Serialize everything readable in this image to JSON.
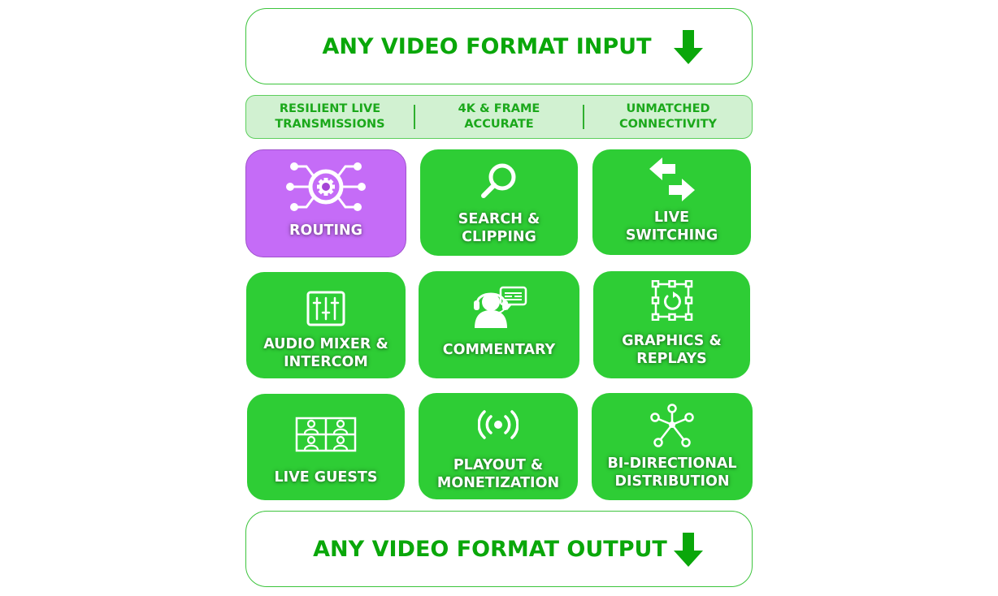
{
  "input_banner": {
    "label": "ANY VIDEO FORMAT INPUT",
    "icon": "arrow-down-icon"
  },
  "features": [
    {
      "label": "RESILIENT LIVE\nTRANSMISSIONS"
    },
    {
      "label": "4K & FRAME\nACCURATE"
    },
    {
      "label": "UNMATCHED\nCONNECTIVITY"
    }
  ],
  "tiles": [
    {
      "label": "ROUTING",
      "icon": "routing-gear-icon",
      "color": "#c56cf7"
    },
    {
      "label": "SEARCH &\nCLIPPING",
      "icon": "search-icon",
      "color": "#2ecd35"
    },
    {
      "label": "LIVE\nSWITCHING",
      "icon": "switch-arrows-icon",
      "color": "#2ecd35"
    },
    {
      "label": "AUDIO MIXER &\nINTERCOM",
      "icon": "audio-mixer-icon",
      "color": "#2ecd35"
    },
    {
      "label": "COMMENTARY",
      "icon": "commentator-headset-icon",
      "color": "#2ecd35"
    },
    {
      "label": "GRAPHICS &\nREPLAYS",
      "icon": "graphics-replay-icon",
      "color": "#2ecd35"
    },
    {
      "label": "LIVE GUESTS",
      "icon": "video-grid-guests-icon",
      "color": "#2ecd35"
    },
    {
      "label": "PLAYOUT &\nMONETIZATION",
      "icon": "broadcast-icon",
      "color": "#2ecd35"
    },
    {
      "label": "BI-DIRECTIONAL\nDISTRIBUTION",
      "icon": "network-hub-icon",
      "color": "#2ecd35"
    }
  ],
  "output_banner": {
    "label": "ANY VIDEO FORMAT OUTPUT",
    "icon": "arrow-down-icon"
  },
  "colors": {
    "green_text": "#0aa70a",
    "tile_green": "#2ecd35",
    "tile_purple": "#c56cf7",
    "feature_bg": "#d1f1d1"
  }
}
